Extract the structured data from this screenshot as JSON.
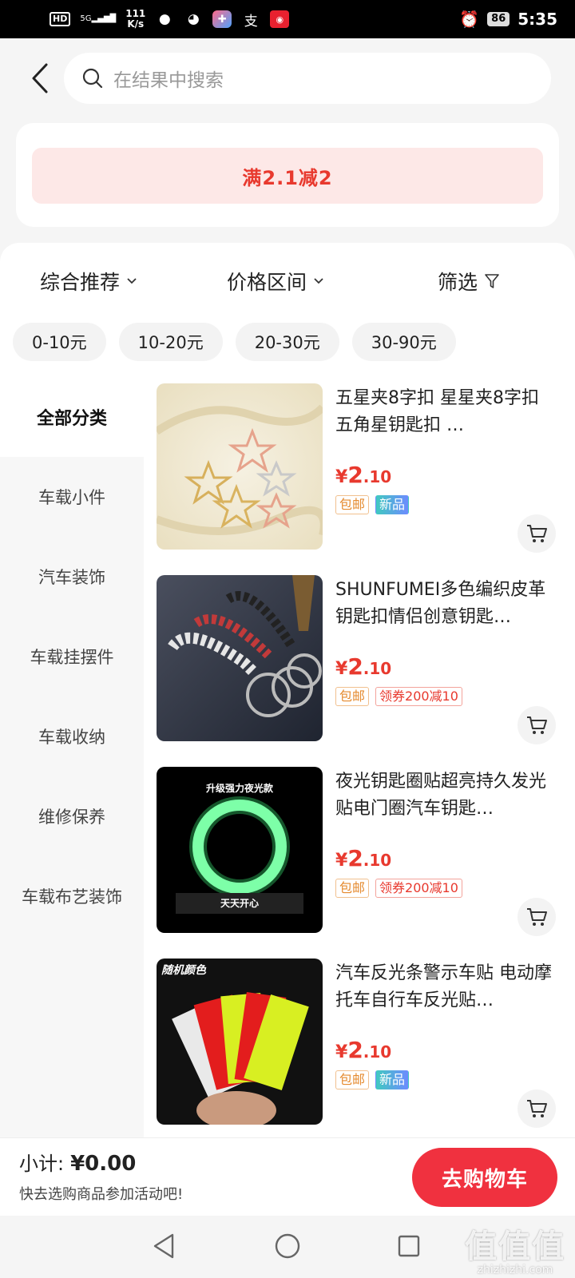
{
  "status_bar": {
    "hd": "HD",
    "network": "5G",
    "speed_value": "111",
    "speed_unit": "K/s",
    "battery": "86",
    "time": "5:35"
  },
  "search": {
    "placeholder": "在结果中搜索"
  },
  "promo": {
    "label": "满2.1减2"
  },
  "sort_bar": {
    "comprehensive": "综合推荐",
    "price_range": "价格区间",
    "filter": "筛选"
  },
  "price_chips": [
    "0-10元",
    "10-20元",
    "20-30元",
    "30-90元"
  ],
  "sidebar": {
    "items": [
      "全部分类",
      "车载小件",
      "汽车装饰",
      "车载挂摆件",
      "车载收纳",
      "维修保养",
      "车载布艺装饰"
    ]
  },
  "products": [
    {
      "title": "五星夹8字扣 星星夹8字扣 五角星钥匙扣 …",
      "price_symbol": "¥",
      "price_int": "2",
      "price_dec": ".10",
      "tag1": "包邮",
      "tag2": "新品",
      "image_caption": ""
    },
    {
      "title": "SHUNFUMEI多色编织皮革钥匙扣情侣创意钥匙…",
      "price_symbol": "¥",
      "price_int": "2",
      "price_dec": ".10",
      "tag1": "包邮",
      "tag2": "领券200减10",
      "image_caption": ""
    },
    {
      "title": "夜光钥匙圈贴超亮持久发光贴电门圈汽车钥匙…",
      "price_symbol": "¥",
      "price_int": "2",
      "price_dec": ".10",
      "tag1": "包邮",
      "tag2": "领券200减10",
      "image_caption": "升级强力夜光款",
      "image_caption2": "天天开心"
    },
    {
      "title": "汽车反光条警示车贴 电动摩托车自行车反光贴…",
      "price_symbol": "¥",
      "price_int": "2",
      "price_dec": ".10",
      "tag1": "包邮",
      "tag2": "新品",
      "image_caption": "随机颜色"
    }
  ],
  "bottom_bar": {
    "subtotal_label": "小计:",
    "subtotal_amount": "¥0.00",
    "hint": "快去选购商品参加活动吧!",
    "go_cart": "去购物车"
  },
  "watermark": {
    "big": "值值值",
    "small": "zhizhizhi.com"
  },
  "colors": {
    "accent_red": "#e8392e",
    "cart_button": "#f0313f",
    "promo_bg": "#fde8e7"
  }
}
